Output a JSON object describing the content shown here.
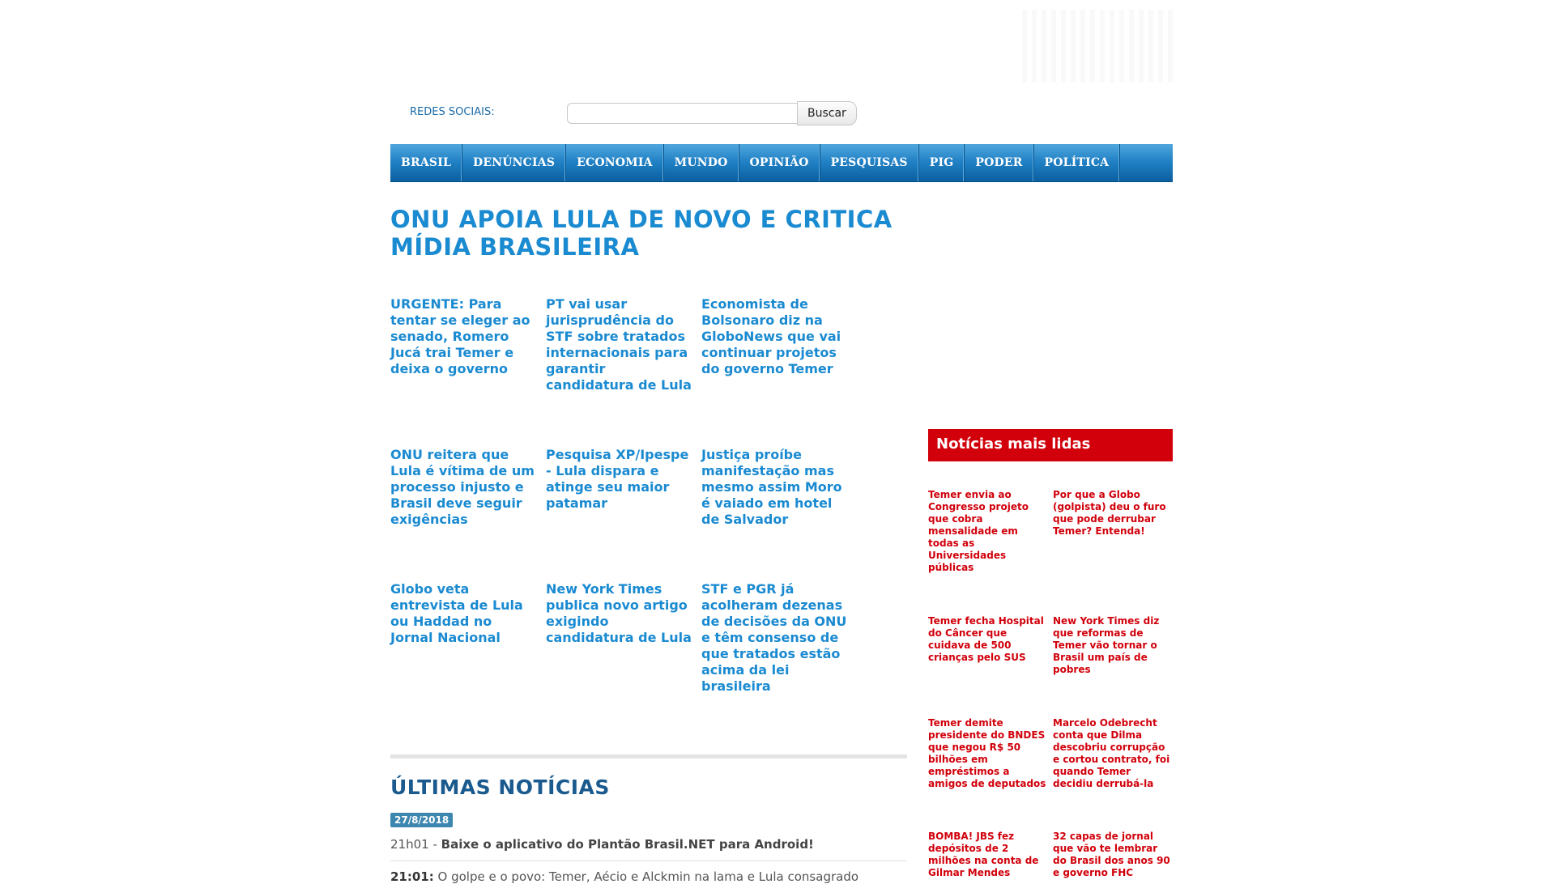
{
  "header": {
    "redes_label": "REDES SOCIAIS:",
    "search_placeholder": "",
    "search_button": "Buscar"
  },
  "nav": [
    "BRASIL",
    "DENÚNCIAS",
    "ECONOMIA",
    "MUNDO",
    "OPINIÃO",
    "PESQUISAS",
    "PIG",
    "PODER",
    "POLÍTICA"
  ],
  "headline": "ONU APOIA LULA DE NOVO E CRITICA MÍDIA BRASILEIRA",
  "news": [
    "URGENTE: Para tentar se eleger ao senado, Romero Jucá trai Temer e deixa o governo",
    "PT vai usar jurisprudência do STF sobre tratados internacionais para garantir candidatura de Lula",
    "Economista de Bolsonaro diz na GloboNews que vai continuar projetos do governo Temer",
    "ONU reitera que Lula é vítima de um processo injusto e Brasil deve seguir exigências",
    "Pesquisa XP/Ipespe - Lula dispara e atinge seu maior patamar",
    "Justiça proíbe manifestação mas mesmo assim Moro é vaiado em hotel de Salvador",
    "Globo veta entrevista de Lula ou Haddad no Jornal Nacional",
    "New York Times publica novo artigo exigindo candidatura de Lula",
    "STF e PGR já acolheram dezenas de decisões da ONU e têm consenso de que tratados estão acima da lei brasileira"
  ],
  "latest": {
    "title": "ÚLTIMAS NOTÍCIAS",
    "date": "27/8/2018",
    "items": [
      {
        "time": "21h01",
        "sep": " - ",
        "text": "Baixe o aplicativo do Plantão Brasil.NET para Android!"
      },
      {
        "time": "21:01:",
        "text": " O golpe e o povo: Temer, Aécio e Alckmin na lama e Lula consagrado"
      }
    ]
  },
  "most_read": {
    "title": "Notícias mais lidas",
    "items": [
      "Temer envia ao Congresso projeto que cobra mensalidade em todas as Universidades públicas",
      "Por que a Globo (golpista) deu o furo que pode derrubar Temer? Entenda!",
      "Temer fecha Hospital do Câncer que cuidava de 500 crianças pelo SUS",
      "New York Times diz que reformas de Temer vão tornar o Brasil um país de pobres",
      "Temer demite presidente do BNDES que negou R$ 50 bilhões em empréstimos a amigos de deputados",
      "Marcelo Odebrecht conta que Dilma descobriu corrupção e cortou contrato, foi quando Temer decidiu derrubá-la",
      "BOMBA! JBS fez depósitos de 2 milhões na conta de Gilmar Mendes",
      "32 capas de jornal que vão te lembrar do Brasil dos anos 90 e governo FHC"
    ]
  }
}
